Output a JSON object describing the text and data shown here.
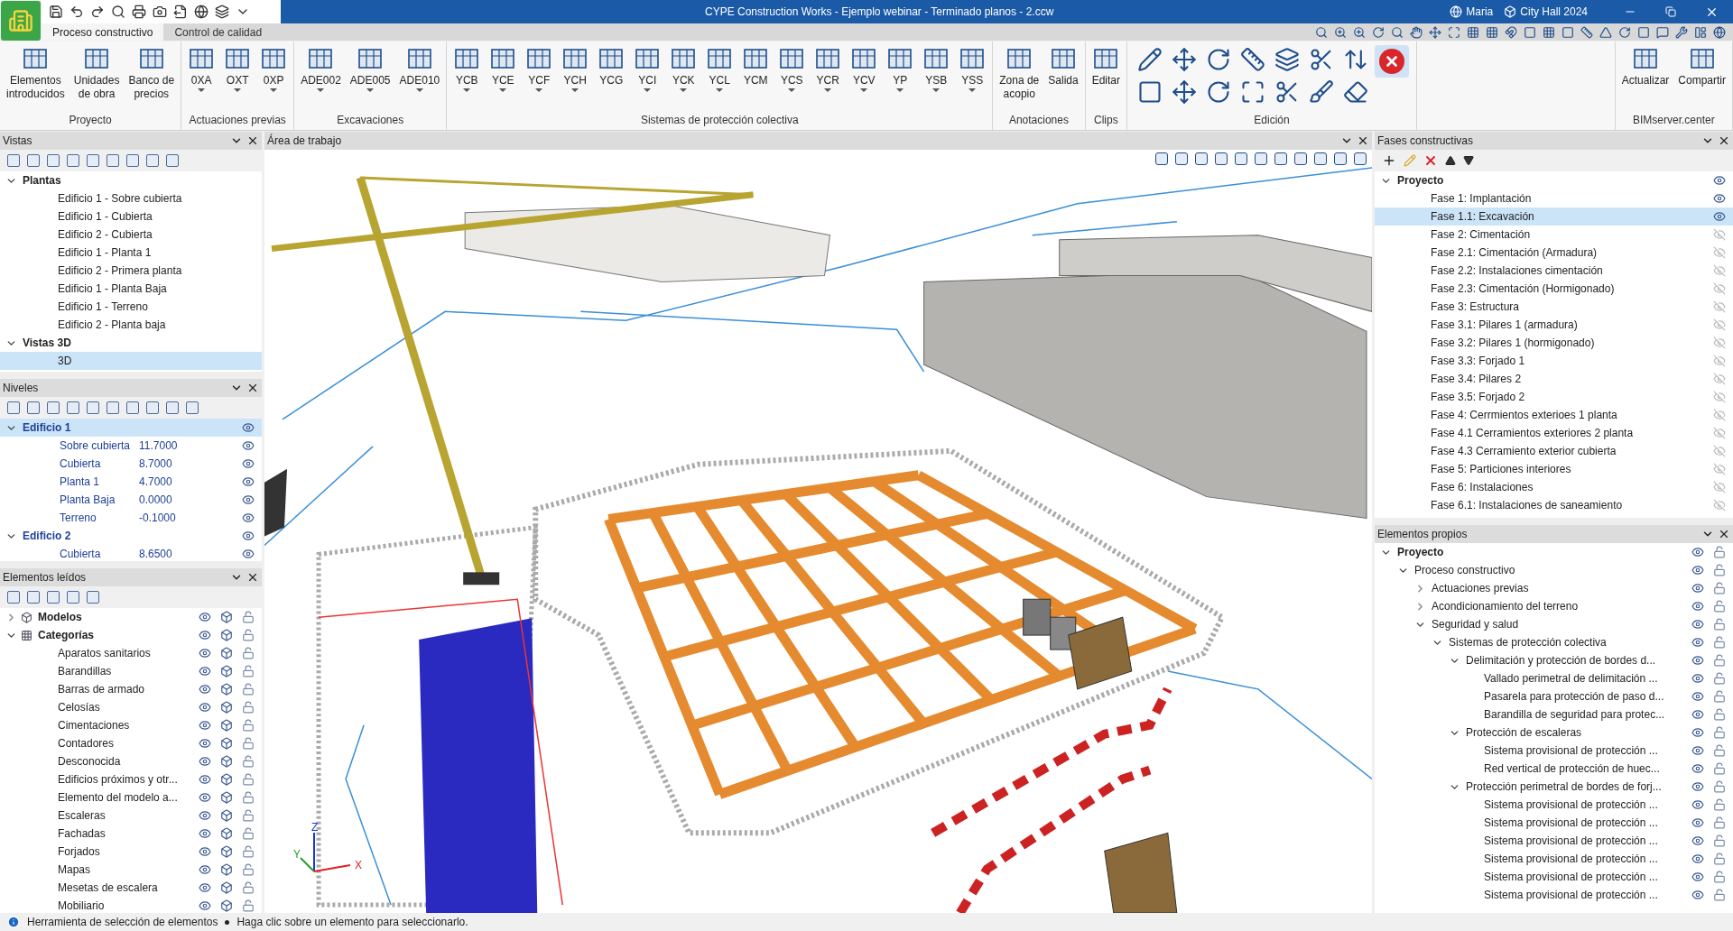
{
  "window": {
    "title": "CYPE Construction Works - Ejemplo webinar - Terminado planos - 2.ccw",
    "user": "Maria",
    "project": "City Hall 2024"
  },
  "tabs": [
    {
      "label": "Proceso constructivo",
      "selected": true
    },
    {
      "label": "Control de calidad",
      "selected": false
    }
  ],
  "ribbon": [
    {
      "label": "Proyecto",
      "buttons": [
        {
          "label": "Elementos\nintroducidos",
          "dropdown": false
        },
        {
          "label": "Unidades\nde obra",
          "dropdown": false
        },
        {
          "label": "Banco de\nprecios",
          "dropdown": false
        }
      ]
    },
    {
      "label": "Actuaciones previas",
      "buttons": [
        {
          "label": "0XA",
          "dropdown": true
        },
        {
          "label": "OXT",
          "dropdown": true
        },
        {
          "label": "0XP",
          "dropdown": true
        }
      ]
    },
    {
      "label": "Excavaciones",
      "buttons": [
        {
          "label": "ADE002",
          "dropdown": true
        },
        {
          "label": "ADE005",
          "dropdown": true
        },
        {
          "label": "ADE010",
          "dropdown": true
        }
      ]
    },
    {
      "label": "Sistemas de protección colectiva",
      "buttons": [
        {
          "label": "YCB",
          "dropdown": true
        },
        {
          "label": "YCE",
          "dropdown": true
        },
        {
          "label": "YCF",
          "dropdown": true
        },
        {
          "label": "YCH",
          "dropdown": true
        },
        {
          "label": "YCG",
          "dropdown": false
        },
        {
          "label": "YCI",
          "dropdown": true
        },
        {
          "label": "YCK",
          "dropdown": true
        },
        {
          "label": "YCL",
          "dropdown": true
        },
        {
          "label": "YCM",
          "dropdown": false
        },
        {
          "label": "YCS",
          "dropdown": true
        },
        {
          "label": "YCR",
          "dropdown": true
        },
        {
          "label": "YCV",
          "dropdown": true
        },
        {
          "label": "YP",
          "dropdown": true
        },
        {
          "label": "YSB",
          "dropdown": true
        },
        {
          "label": "YSS",
          "dropdown": true
        }
      ]
    },
    {
      "label": "Anotaciones",
      "buttons": [
        {
          "label": "Zona de\nacopio",
          "dropdown": false
        },
        {
          "label": "Salida",
          "dropdown": false
        }
      ]
    },
    {
      "label": "Clips",
      "buttons": [
        {
          "label": "Editar",
          "dropdown": false
        }
      ]
    },
    {
      "label": "Edición",
      "kind": "icons"
    },
    {
      "label": "BIMserver.center",
      "buttons": [
        {
          "label": "Actualizar",
          "dropdown": false
        },
        {
          "label": "Compartir",
          "dropdown": false
        }
      ]
    }
  ],
  "vistas": {
    "title": "Vistas",
    "items": [
      {
        "label": "Plantas",
        "expanded": true,
        "children": [
          {
            "label": "Edificio 1 - Sobre cubierta",
            "selected": false
          },
          {
            "label": "Edificio 1 - Cubierta",
            "selected": false
          },
          {
            "label": "Edificio 2 - Cubierta",
            "selected": false
          },
          {
            "label": "Edificio 1 - Planta 1",
            "selected": false
          },
          {
            "label": "Edificio 2 - Primera planta",
            "selected": false
          },
          {
            "label": "Edificio 1 - Planta Baja",
            "selected": false
          },
          {
            "label": "Edificio 1 - Terreno",
            "selected": false
          },
          {
            "label": "Edificio 2 - Planta baja",
            "selected": false
          }
        ]
      },
      {
        "label": "Vistas 3D",
        "expanded": true,
        "children": [
          {
            "label": "3D",
            "selected": true
          }
        ]
      }
    ]
  },
  "niveles": {
    "title": "Niveles",
    "items": [
      {
        "label": "Edificio 1",
        "expanded": true,
        "selected": true,
        "children": [
          {
            "label": "Sobre cubierta",
            "value": "11.7000",
            "selected": false
          },
          {
            "label": "Cubierta",
            "value": "8.7000",
            "selected": false
          },
          {
            "label": "Planta 1",
            "value": "4.7000",
            "selected": false
          },
          {
            "label": "Planta Baja",
            "value": "0.0000",
            "selected": false
          },
          {
            "label": "Terreno",
            "value": "-0.1000",
            "selected": false
          }
        ]
      },
      {
        "label": "Edificio 2",
        "expanded": true,
        "selected": false,
        "children": [
          {
            "label": "Cubierta",
            "value": "8.6500",
            "selected": false
          }
        ]
      }
    ]
  },
  "elementos_leidos": {
    "title": "Elementos leídos",
    "items": [
      {
        "label": "Modelos",
        "expanded": false,
        "kind": "models"
      },
      {
        "label": "Categorías",
        "expanded": true,
        "kind": "categories",
        "children": [
          {
            "label": "Aparatos sanitarios"
          },
          {
            "label": "Barandillas"
          },
          {
            "label": "Barras de armado"
          },
          {
            "label": "Celosías"
          },
          {
            "label": "Cimentaciones"
          },
          {
            "label": "Contadores"
          },
          {
            "label": "Desconocida"
          },
          {
            "label": "Edificios próximos y otr..."
          },
          {
            "label": "Elemento del modelo a..."
          },
          {
            "label": "Escaleras"
          },
          {
            "label": "Fachadas"
          },
          {
            "label": "Forjados"
          },
          {
            "label": "Mapas"
          },
          {
            "label": "Mesetas de escalera"
          },
          {
            "label": "Mobiliario"
          }
        ]
      }
    ]
  },
  "viewport": {
    "title": "Área de trabajo",
    "axes": [
      "X",
      "Y",
      "Z"
    ]
  },
  "fases": {
    "title": "Fases constructivas",
    "items": [
      {
        "label": "Proyecto",
        "expanded": true,
        "visible": true,
        "children": [
          {
            "label": "Fase 1: Implantación",
            "visible": true,
            "selected": false
          },
          {
            "label": "Fase 1.1: Excavación",
            "visible": true,
            "selected": true
          },
          {
            "label": "Fase 2: Cimentación",
            "visible": false,
            "selected": false
          },
          {
            "label": "Fase 2.1: Cimentación (Armadura)",
            "visible": false,
            "selected": false
          },
          {
            "label": "Fase 2.2: Instalaciones cimentación",
            "visible": false,
            "selected": false
          },
          {
            "label": "Fase 2.3: Cimentación (Hormigonado)",
            "visible": false,
            "selected": false
          },
          {
            "label": "Fase 3: Estructura",
            "visible": false,
            "selected": false
          },
          {
            "label": "Fase 3.1: Pilares 1 (armadura)",
            "visible": false,
            "selected": false
          },
          {
            "label": "Fase 3.2: Pilares 1 (hormigonado)",
            "visible": false,
            "selected": false
          },
          {
            "label": "Fase 3.3: Forjado 1",
            "visible": false,
            "selected": false
          },
          {
            "label": "Fase 3.4: Pilares 2",
            "visible": false,
            "selected": false
          },
          {
            "label": "Fase 3.5: Forjado 2",
            "visible": false,
            "selected": false
          },
          {
            "label": "Fase 4: Cerrmientos exterioes 1 planta",
            "visible": false,
            "selected": false
          },
          {
            "label": "Fase 4.1 Cerramientos exteriores 2 planta",
            "visible": false,
            "selected": false
          },
          {
            "label": "Fase 4.3 Cerramiento exterior cubierta",
            "visible": false,
            "selected": false
          },
          {
            "label": "Fase 5: Particiones interiores",
            "visible": false,
            "selected": false
          },
          {
            "label": "Fase 6: Instalaciones",
            "visible": false,
            "selected": false
          },
          {
            "label": "Fase 6.1: Instalaciones de saneamiento",
            "visible": false,
            "selected": false
          }
        ]
      }
    ]
  },
  "elementos_propios": {
    "title": "Elementos propios",
    "items": [
      {
        "label": "Proyecto",
        "expanded": true,
        "children": [
          {
            "label": "Proceso constructivo",
            "expanded": true,
            "children": [
              {
                "label": "Actuaciones previas",
                "expanded": false
              },
              {
                "label": "Acondicionamiento del terreno",
                "expanded": false
              },
              {
                "label": "Seguridad y salud",
                "expanded": true,
                "children": [
                  {
                    "label": "Sistemas de protección colectiva",
                    "expanded": true,
                    "children": [
                      {
                        "label": "Delimitación y protección de bordes d...",
                        "expanded": true,
                        "children": [
                          {
                            "label": "Vallado perimetral de delimitación ..."
                          },
                          {
                            "label": "Pasarela para protección de paso d..."
                          },
                          {
                            "label": "Barandilla de seguridad para protec..."
                          }
                        ]
                      },
                      {
                        "label": "Protección de escaleras",
                        "expanded": true,
                        "children": [
                          {
                            "label": "Sistema provisional de protección ..."
                          },
                          {
                            "label": "Red vertical de protección de huec..."
                          }
                        ]
                      },
                      {
                        "label": "Protección perimetral de bordes de forj...",
                        "expanded": true,
                        "children": [
                          {
                            "label": "Sistema provisional de protección ..."
                          },
                          {
                            "label": "Sistema provisional de protección ..."
                          },
                          {
                            "label": "Sistema provisional de protección ..."
                          },
                          {
                            "label": "Sistema provisional de protección ..."
                          },
                          {
                            "label": "Sistema provisional de protección ..."
                          },
                          {
                            "label": "Sistema provisional de protección ..."
                          }
                        ]
                      }
                    ]
                  }
                ]
              }
            ]
          }
        ]
      }
    ]
  },
  "status_bar": {
    "tool": "Herramienta de selección de elementos",
    "hint": "Haga clic sobre un elemento para seleccionarlo."
  }
}
